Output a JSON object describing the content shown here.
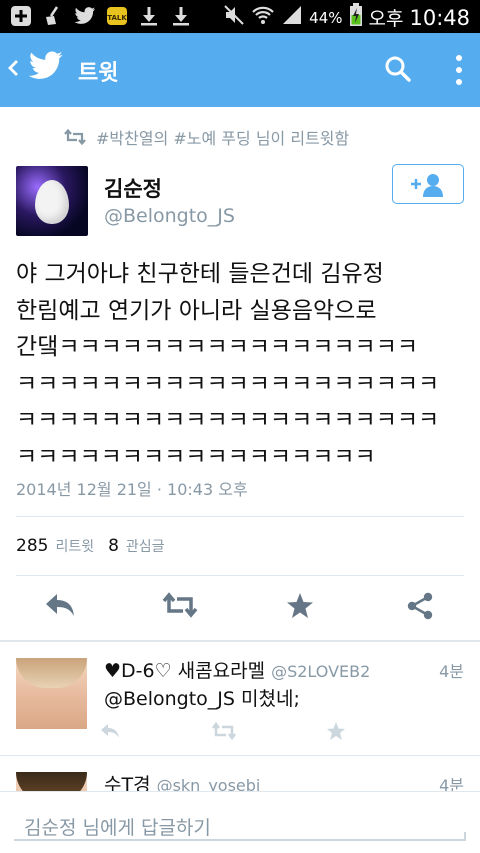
{
  "status_bar": {
    "battery": "44%",
    "ampm": "오후",
    "time": "10:48",
    "talk_label": "TALK"
  },
  "app_bar": {
    "title": "트윗",
    "back_icon": "chevron-left-icon",
    "logo_icon": "twitter-bird-icon",
    "search_icon": "search-icon",
    "more_icon": "more-vert-icon"
  },
  "retweet_header": {
    "text": "#박찬열의 #노예 푸딩 님이 리트윗함"
  },
  "tweet": {
    "name": "김순정",
    "handle": "@Belongto_JS",
    "lines": [
      "야 그거아냐 친구한테 들은건데 김유정",
      "한림예고 연기가 아니라 실용음악으로",
      "간댘ㅋㅋㅋㅋㅋㅋㅋㅋㅋㅋㅋㅋㅋㅋㅋㅋㅋ",
      "ㅋㅋㅋㅋㅋㅋㅋㅋㅋㅋㅋㅋㅋㅋㅋㅋㅋㅋㅋㅋ",
      "ㅋㅋㅋㅋㅋㅋㅋㅋㅋㅋㅋㅋㅋㅋㅋㅋㅋㅋㅋㅋ",
      "ㅋㅋㅋㅋㅋㅋㅋㅋㅋㅋㅋㅋㅋㅋㅋㅋㅋ"
    ],
    "date": "2014년 12월 21일 · 10:43 오후",
    "retweet_count": "285",
    "retweet_label": "리트윗",
    "fav_count": "8",
    "fav_label": "관심글"
  },
  "replies": [
    {
      "name": "♥D-6♡ 새콤요라멜",
      "handle": "@S2LOVEB2",
      "time": "4분",
      "text": "@Belongto_JS 미쳤네;"
    },
    {
      "name": "수T경",
      "handle": "@skn_yosebi",
      "time": "4분",
      "text": ""
    }
  ],
  "compose": {
    "placeholder": "김순정 님에게 답글하기"
  },
  "colors": {
    "accent": "#55acee",
    "muted": "#8899a6",
    "divider": "#e1e8ed"
  }
}
